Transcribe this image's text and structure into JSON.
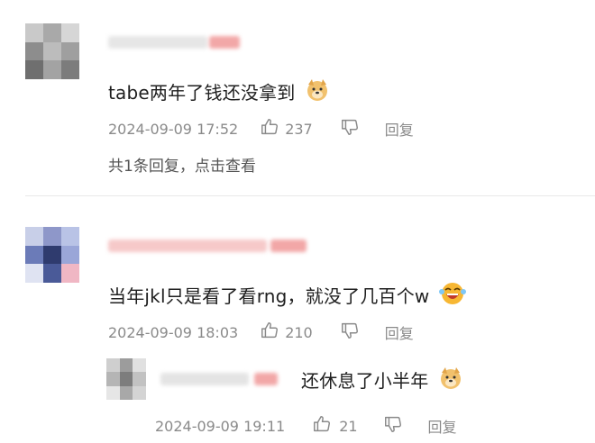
{
  "comments": [
    {
      "text": "tabe两年了钱还没拿到",
      "date": "2024-09-09 17:52",
      "likes": "237",
      "reply_label": "回复",
      "more_replies": "共1条回复，点击查看"
    },
    {
      "text": "当年jkl只是看了看rng，就没了几百个w",
      "date": "2024-09-09 18:03",
      "likes": "210",
      "reply_label": "回复"
    }
  ],
  "reply": {
    "text": "还休息了小半年",
    "date": "2024-09-09 19:11",
    "likes": "21",
    "reply_label": "回复"
  },
  "icons": {
    "like": "thumbs-up-icon",
    "dislike": "thumbs-down-icon",
    "doge": "doge-emoji",
    "laugh": "laughing-emoji"
  },
  "colors": {
    "meta": "#8a8a8a",
    "username_blur": "#f4b6b6",
    "text": "#1f1f1f"
  }
}
